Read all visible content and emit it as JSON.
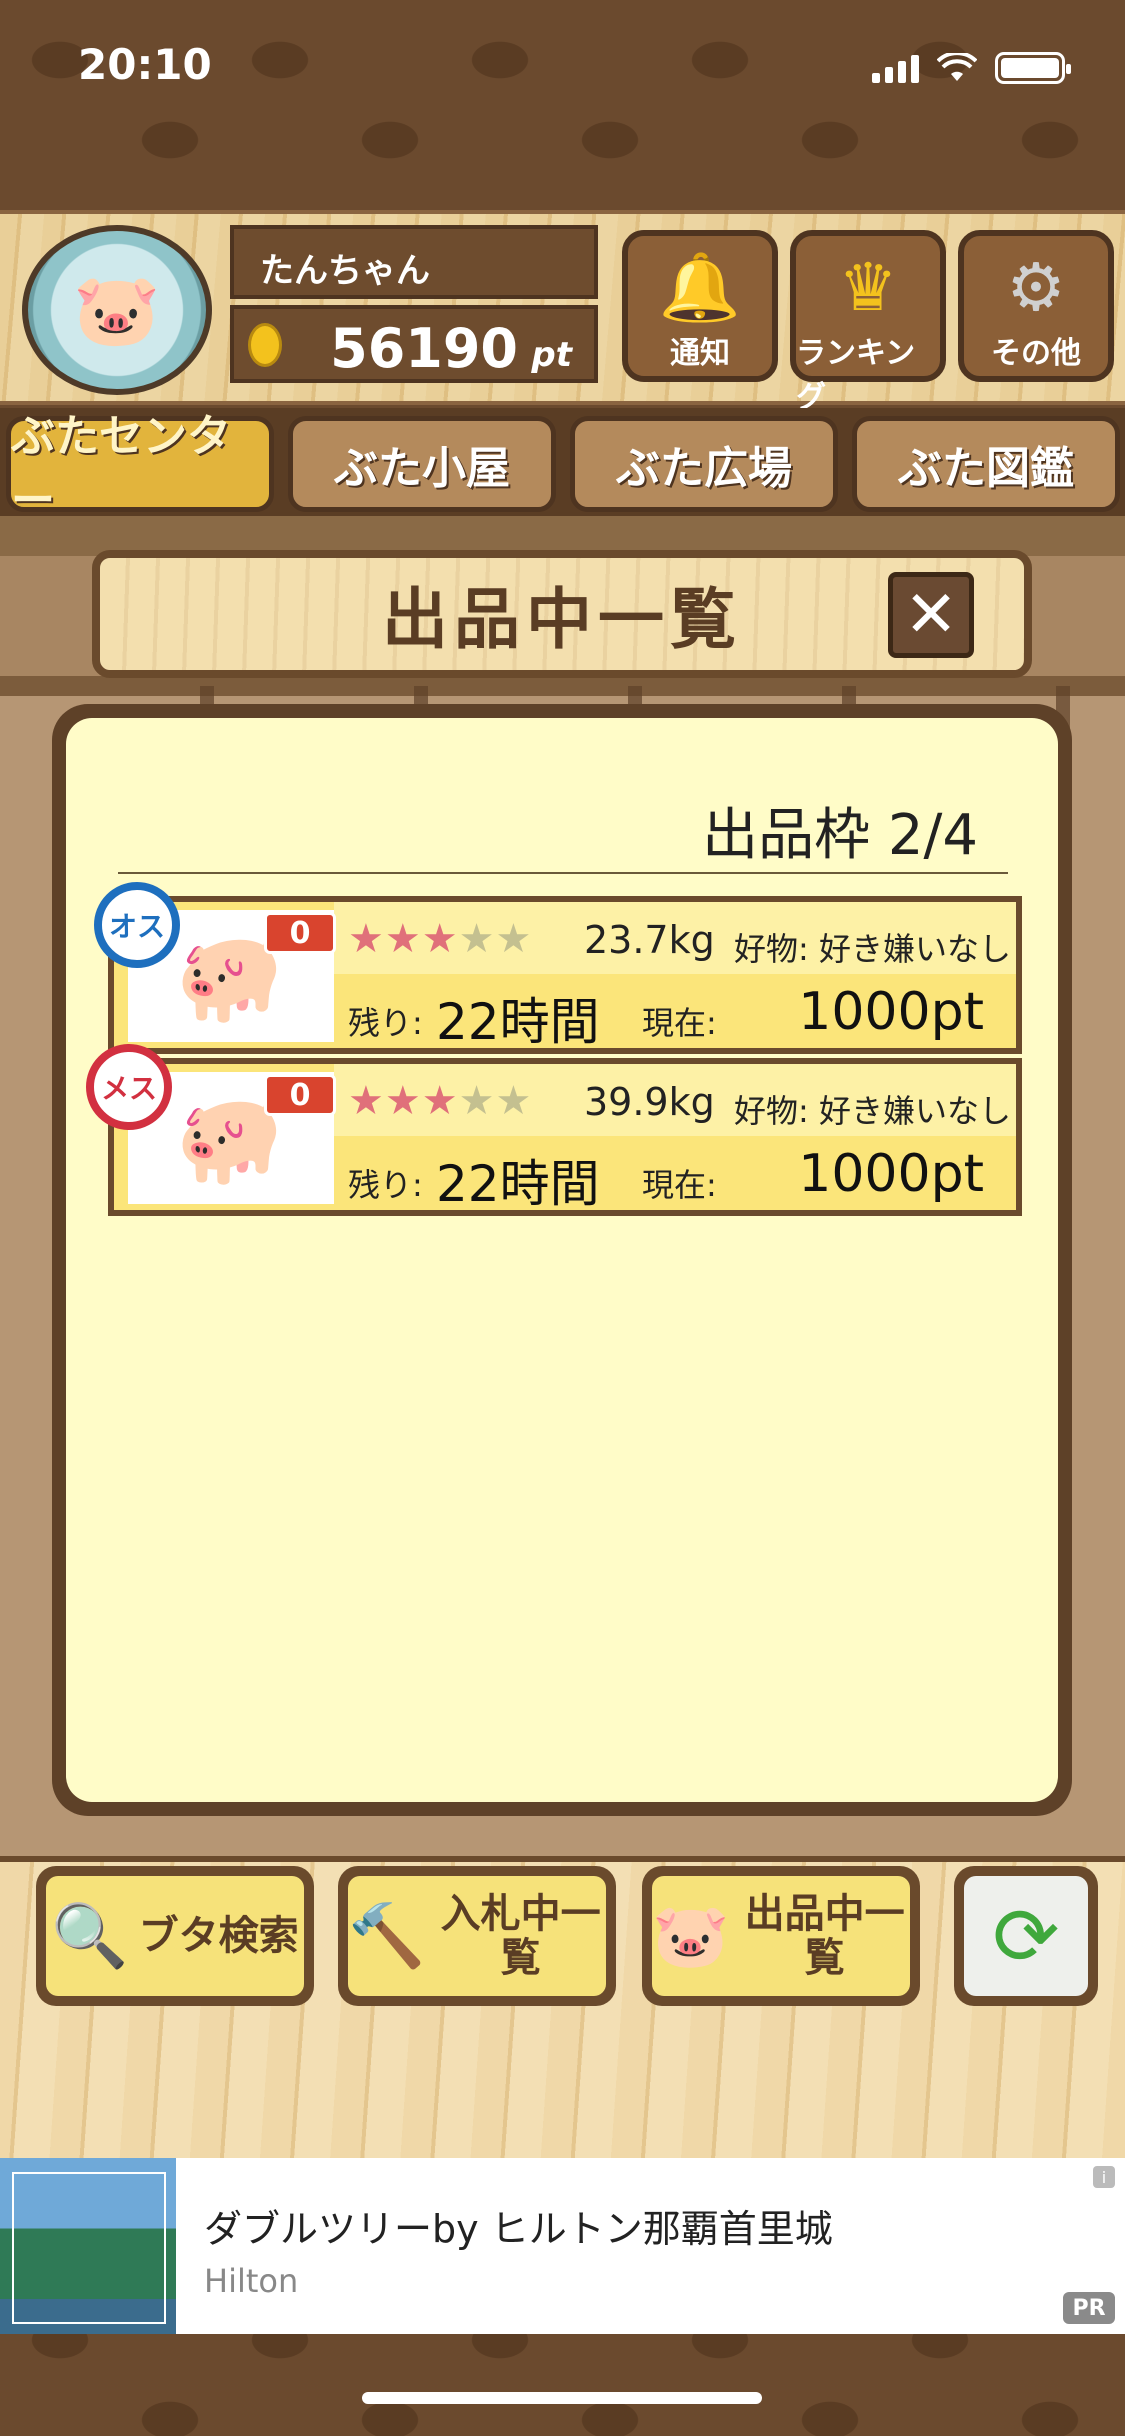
{
  "status_bar": {
    "time": "20:10"
  },
  "header": {
    "user_name": "たんちゃん",
    "points": "56190",
    "points_unit": "pt",
    "buttons": [
      {
        "label": "通知",
        "icon": "bell-icon"
      },
      {
        "label": "ランキング",
        "icon": "crown-icon"
      },
      {
        "label": "その他",
        "icon": "gear-icon"
      }
    ]
  },
  "tabs": [
    {
      "label": "ぶたセンター",
      "active": true
    },
    {
      "label": "ぶた小屋",
      "active": false
    },
    {
      "label": "ぶた広場",
      "active": false
    },
    {
      "label": "ぶた図鑑",
      "active": false
    }
  ],
  "dialog": {
    "title": "出品中一覧",
    "slots": "出品枠 2/4"
  },
  "listings": [
    {
      "gender": "オス",
      "bid_count": "0",
      "stars": 3,
      "stars_max": 5,
      "weight": "23.7kg",
      "favorite": "好物: 好き嫌いなし",
      "remaining_label": "残り:",
      "remaining": "22時間",
      "current_label": "現在:",
      "current": "1000pt"
    },
    {
      "gender": "メス",
      "bid_count": "0",
      "stars": 3,
      "stars_max": 5,
      "weight": "39.9kg",
      "favorite": "好物: 好き嫌いなし",
      "remaining_label": "残り:",
      "remaining": "22時間",
      "current_label": "現在:",
      "current": "1000pt"
    }
  ],
  "bottom_buttons": [
    {
      "label": "ブタ検索",
      "icon": "magnifier-icon"
    },
    {
      "label": "入札中一覧",
      "icon": "gavel-icon"
    },
    {
      "label": "出品中一覧",
      "icon": "pig-icon"
    },
    {
      "label": "",
      "icon": "refresh-icon"
    }
  ],
  "ad": {
    "title": "ダブルツリーby ヒルトン那覇首里城",
    "advertiser": "Hilton",
    "badge": "PR",
    "info": "i"
  }
}
